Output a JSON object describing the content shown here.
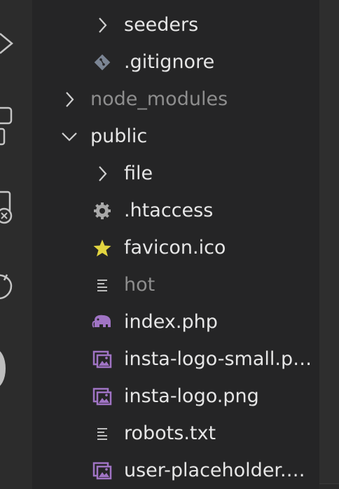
{
  "tree": {
    "items": [
      {
        "label": "seeders",
        "icon": "chevron-right-icon",
        "type": "folder",
        "expanded": false
      },
      {
        "label": ".gitignore",
        "icon": "git-icon",
        "type": "file"
      },
      {
        "label": "node_modules",
        "icon": "chevron-right-icon",
        "type": "folder",
        "expanded": false,
        "dimmed": true
      },
      {
        "label": "public",
        "icon": "chevron-down-icon",
        "type": "folder",
        "expanded": true
      },
      {
        "label": "file",
        "icon": "chevron-right-icon",
        "type": "folder",
        "expanded": false
      },
      {
        "label": ".htaccess",
        "icon": "gear-icon",
        "type": "file"
      },
      {
        "label": "favicon.ico",
        "icon": "star-icon",
        "type": "file"
      },
      {
        "label": "hot",
        "icon": "text-lines-icon",
        "type": "file",
        "dimmed": true
      },
      {
        "label": "index.php",
        "icon": "php-elephant-icon",
        "type": "file"
      },
      {
        "label": "insta-logo-small.png",
        "icon": "image-icon",
        "type": "file"
      },
      {
        "label": "insta-logo.png",
        "icon": "image-icon",
        "type": "file"
      },
      {
        "label": "robots.txt",
        "icon": "text-lines-icon",
        "type": "file"
      },
      {
        "label": "user-placeholder.png",
        "icon": "image-icon",
        "type": "file"
      }
    ]
  },
  "colors": {
    "background": "#252526",
    "activity_bar": "#2c2c2c",
    "text": "#e6e6e6",
    "dimmed_text": "#8e8e8e",
    "php_purple": "#a074c4",
    "star_yellow": "#e2d540",
    "gear_gray": "#a8a8a8",
    "git_gray": "#8a93a0"
  }
}
